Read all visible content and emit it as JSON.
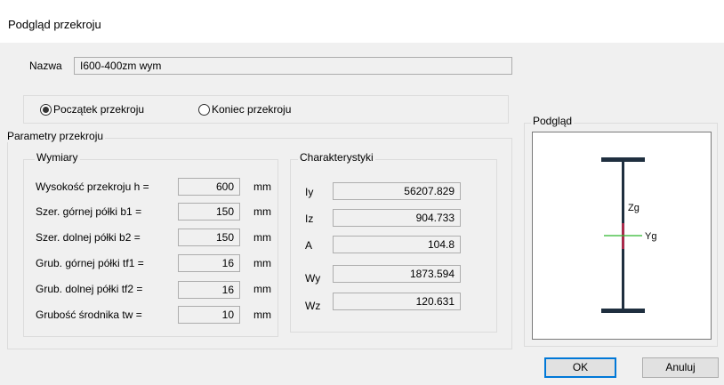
{
  "window": {
    "title": "Podgląd przekroju"
  },
  "name": {
    "label": "Nazwa",
    "value": "I600-400zm wym"
  },
  "position": {
    "options": [
      {
        "label": "Początek przekroju",
        "selected": true
      },
      {
        "label": "Koniec przekroju",
        "selected": false
      }
    ]
  },
  "params": {
    "title": "Parametry przekroju",
    "dims": {
      "title": "Wymiary",
      "rows": [
        {
          "label": "Wysokość przekroju h =",
          "value": "600",
          "unit": "mm"
        },
        {
          "label": "Szer. górnej półki b1 =",
          "value": "150",
          "unit": "mm"
        },
        {
          "label": "Szer. dolnej półki b2 =",
          "value": "150",
          "unit": "mm"
        },
        {
          "label": "Grub. górnej półki tf1 =",
          "value": "16",
          "unit": "mm"
        },
        {
          "label": "Grub. dolnej półki tf2 =",
          "value": "16",
          "unit": "mm"
        },
        {
          "label": "Grubość środnika tw =",
          "value": "10",
          "unit": "mm"
        }
      ]
    },
    "chars": {
      "title": "Charakterystyki",
      "rows": [
        {
          "label": "Iy",
          "value": "56207.829"
        },
        {
          "label": "Iz",
          "value": "904.733"
        },
        {
          "label": "A",
          "value": "104.8"
        },
        {
          "label": "Wy",
          "value": "1873.594"
        },
        {
          "label": "Wz",
          "value": "120.631"
        }
      ]
    }
  },
  "preview": {
    "title": "Podgląd",
    "axis_z": "Zg",
    "axis_y": "Yg",
    "colors": {
      "beam": "#1f2f3f",
      "axis_y": "#2eb82e",
      "axis_z": "#e0284f"
    }
  },
  "buttons": {
    "ok": "OK",
    "cancel": "Anuluj"
  }
}
